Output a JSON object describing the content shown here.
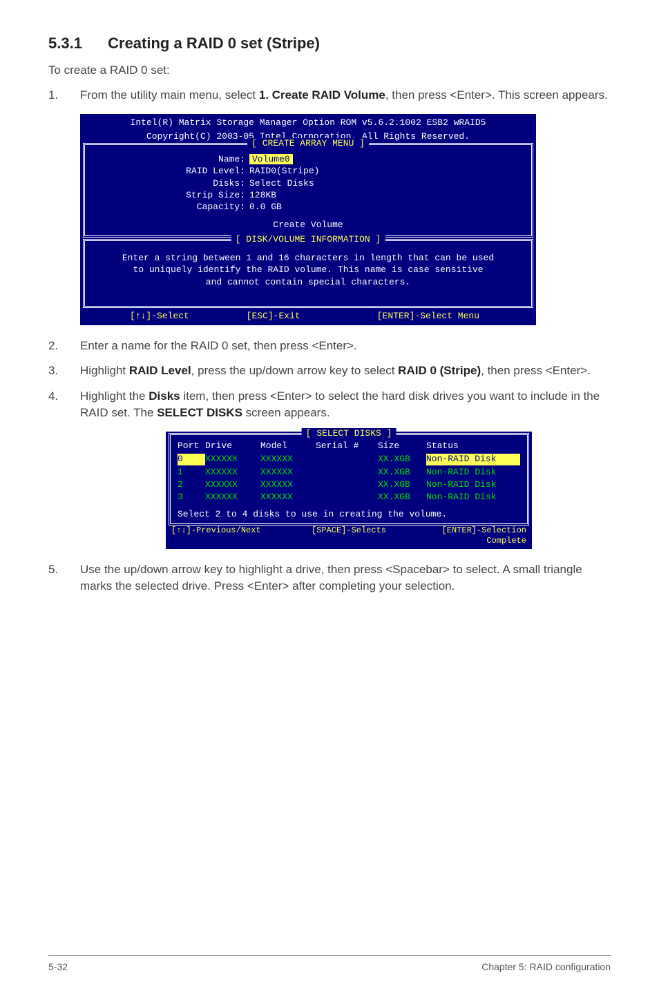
{
  "section": {
    "number": "5.3.1",
    "title": "Creating a RAID 0 set (Stripe)",
    "intro": "To create a RAID 0 set:"
  },
  "steps": {
    "s1": {
      "n": "1.",
      "t_a": "From the utility main menu, select ",
      "t_b": "1. Create RAID Volume",
      "t_c": ", then press <Enter>. This screen appears."
    },
    "s2": {
      "n": "2.",
      "t": "Enter a name for the RAID 0 set, then press <Enter>."
    },
    "s3": {
      "n": "3.",
      "t_a": "Highlight ",
      "t_b": "RAID Level",
      "t_c": ", press the up/down arrow key to select ",
      "t_d": "RAID 0 (Stripe)",
      "t_e": ", then press <Enter>."
    },
    "s4": {
      "n": "4.",
      "t_a": "Highlight the ",
      "t_b": "Disks",
      "t_c": " item, then press <Enter> to select the hard disk drives you want to include in the RAID set. The ",
      "t_d": "SELECT DISKS",
      "t_e": " screen appears."
    },
    "s5": {
      "n": "5.",
      "t": "Use the up/down arrow key to highlight a drive, then press <Spacebar> to select. A small triangle marks the selected drive. Press <Enter> after completing your selection."
    }
  },
  "bios1": {
    "top1": "Intel(R) Matrix Storage Manager Option ROM v5.6.2.1002 ESB2 wRAID5",
    "top2": "Copyright(C) 2003-05 Intel Corporation. All Rights Reserved.",
    "frame1_title": "[ CREATE ARRAY MENU ]",
    "rows": {
      "name_l": "Name:",
      "name_v": "Volume0",
      "raid_l": "RAID Level:",
      "raid_v": "RAID0(Stripe)",
      "disks_l": "Disks:",
      "disks_v": "Select Disks",
      "strip_l": "Strip Size:",
      "strip_v": "128KB",
      "cap_l": "Capacity:",
      "cap_v": "0.0   GB"
    },
    "create": "Create Volume",
    "frame2_title": "[ DISK/VOLUME INFORMATION ]",
    "info1": "Enter a string between 1 and 16 characters in length that can be used",
    "info2": "to uniquely identify the RAID volume. This name is case sensitive",
    "info3": "and cannot contain special characters.",
    "bb_left": "[↑↓]-Select",
    "bb_mid": "[ESC]-Exit",
    "bb_right": "[ENTER]-Select Menu"
  },
  "bios2": {
    "title": "[ SELECT DISKS ]",
    "hdr": {
      "c1": "Port",
      "c2": "Drive",
      "c3": "Model",
      "c4": "Serial #",
      "c5": "Size",
      "c6": "Status"
    },
    "rows": [
      {
        "c1": "0",
        "c2": "XXXXXX",
        "c3": "XXXXXX",
        "c4": "",
        "c5": "XX.XGB",
        "c6": "Non-RAID Disk"
      },
      {
        "c1": "1",
        "c2": "XXXXXX",
        "c3": "XXXXXX",
        "c4": "",
        "c5": "XX.XGB",
        "c6": "Non-RAID Disk"
      },
      {
        "c1": "2",
        "c2": "XXXXXX",
        "c3": "XXXXXX",
        "c4": "",
        "c5": "XX.XGB",
        "c6": "Non-RAID Disk"
      },
      {
        "c1": "3",
        "c2": "XXXXXX",
        "c3": "XXXXXX",
        "c4": "",
        "c5": "XX.XGB",
        "c6": "Non-RAID Disk"
      }
    ],
    "msg": "Select 2 to 4 disks to use in creating the volume.",
    "bb1": "[↑↓]-Previous/Next",
    "bb2": "[SPACE]-Selects",
    "bb3": "[ENTER]-Selection Complete"
  },
  "footer": {
    "left": "5-32",
    "right": "Chapter 5: RAID configuration"
  }
}
